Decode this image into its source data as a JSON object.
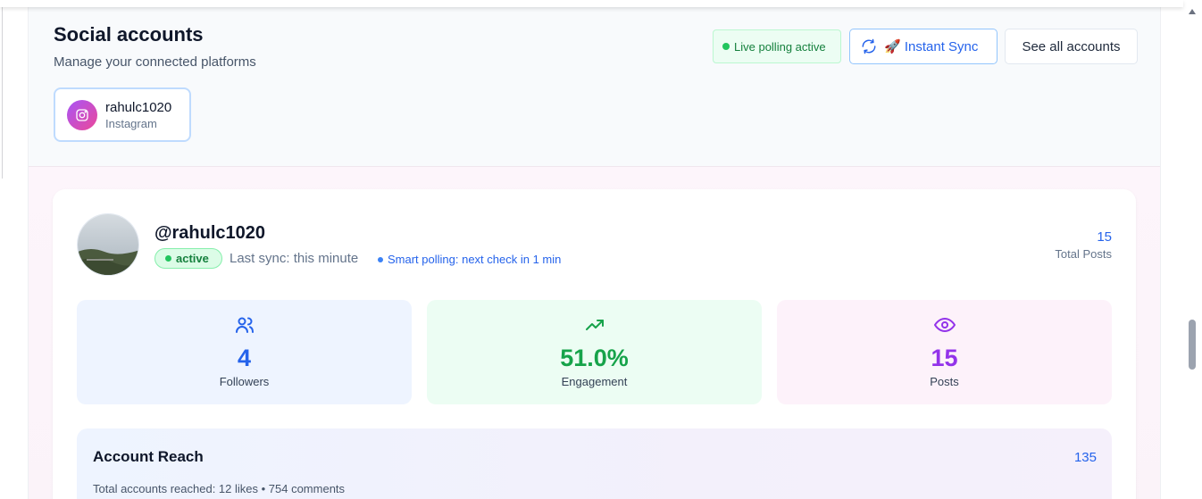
{
  "header": {
    "title": "Social accounts",
    "subtitle": "Manage your connected platforms",
    "live_badge": "Live polling active",
    "sync_button": "🚀 Instant Sync",
    "see_all_button": "See all accounts"
  },
  "accounts": [
    {
      "name": "rahulc1020",
      "platform": "Instagram",
      "icon": "instagram-icon"
    }
  ],
  "profile": {
    "handle": "@rahulc1020",
    "status": "active",
    "last_sync": "Last sync: this minute",
    "polling": "Smart polling: next check in 1 min",
    "total_posts_value": "15",
    "total_posts_label": "Total Posts"
  },
  "stats": [
    {
      "icon": "users-icon",
      "value": "4",
      "label": "Followers",
      "color": "#2563eb"
    },
    {
      "icon": "trending-up-icon",
      "value": "51.0%",
      "label": "Engagement",
      "color": "#16a34a"
    },
    {
      "icon": "eye-icon",
      "value": "15",
      "label": "Posts",
      "color": "#9333ea"
    }
  ],
  "reach": {
    "title": "Account Reach",
    "value": "135",
    "description": "Total accounts reached: 12 likes • 754 comments"
  },
  "colors": {
    "accent": "#2563eb",
    "success": "#16a34a",
    "purple": "#9333ea"
  }
}
